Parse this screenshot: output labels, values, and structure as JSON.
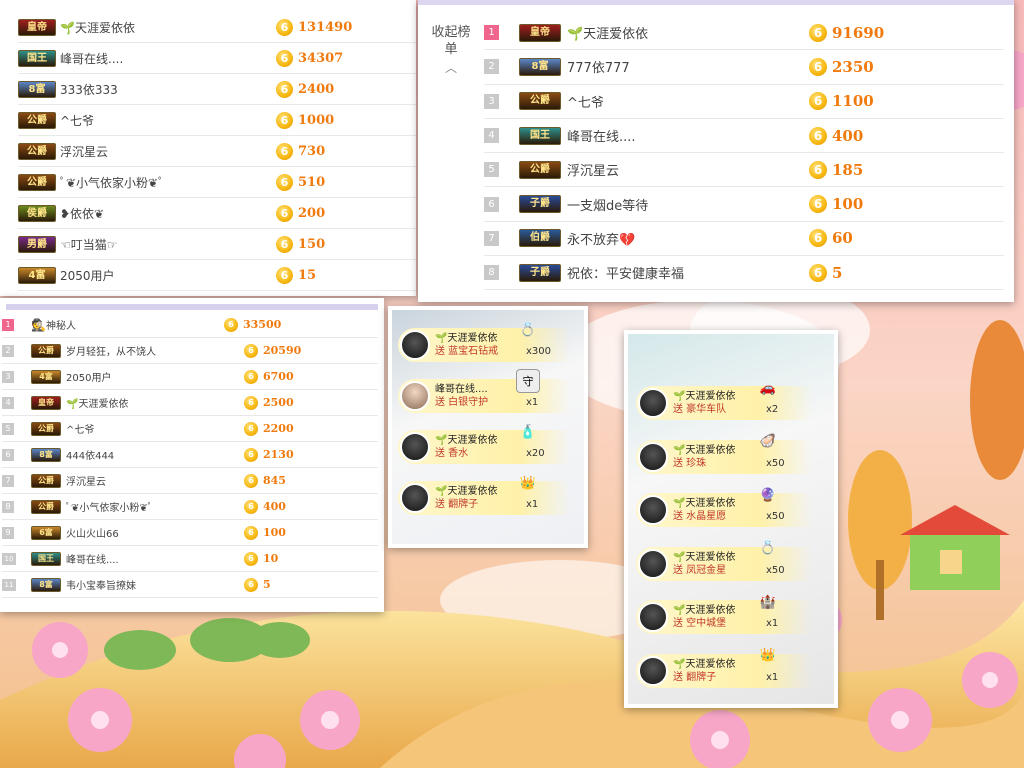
{
  "panel_top_left": {
    "rows": [
      {
        "badge": "皇帝",
        "badge_color": "#a01e1e",
        "name": "🌱天涯爱依依",
        "score": "131490"
      },
      {
        "badge": "国王",
        "badge_color": "#2e8f8a",
        "name": "峰哥在线....",
        "score": "34307"
      },
      {
        "badge": "8富",
        "badge_color": "#5a86c8",
        "name": "333依333",
        "score": "2400"
      },
      {
        "badge": "公爵",
        "badge_color": "#8a4a12",
        "name": "^七爷",
        "score": "1000"
      },
      {
        "badge": "公爵",
        "badge_color": "#8a4a12",
        "name": "浮沉星云",
        "score": "730"
      },
      {
        "badge": "公爵",
        "badge_color": "#8a4a12",
        "name": "ﾟ❦小气依家小粉❦ﾟ",
        "score": "510"
      },
      {
        "badge": "侯爵",
        "badge_color": "#6b8a1e",
        "name": "❥依依❦",
        "score": "200"
      },
      {
        "badge": "男爵",
        "badge_color": "#7a2a8a",
        "name": "☜叮当猫☞",
        "score": "150"
      },
      {
        "badge": "4富",
        "badge_color": "#c8882a",
        "name": "2050用户",
        "score": "15"
      }
    ]
  },
  "panel_top_right": {
    "collapse_label": "收起榜单",
    "collapse_icon": "chevron-up-icon",
    "rows": [
      {
        "rank": "1",
        "badge": "皇帝",
        "badge_color": "#a01e1e",
        "name": "🌱天涯爱依依",
        "score": "91690"
      },
      {
        "rank": "2",
        "badge": "8富",
        "badge_color": "#5a86c8",
        "name": "777依777",
        "score": "2350"
      },
      {
        "rank": "3",
        "badge": "公爵",
        "badge_color": "#8a4a12",
        "name": "^七爷",
        "score": "1100"
      },
      {
        "rank": "4",
        "badge": "国王",
        "badge_color": "#2e8f8a",
        "name": "峰哥在线....",
        "score": "400"
      },
      {
        "rank": "5",
        "badge": "公爵",
        "badge_color": "#8a4a12",
        "name": "浮沉星云",
        "score": "185"
      },
      {
        "rank": "6",
        "badge": "子爵",
        "badge_color": "#2a4a9a",
        "name": "一支烟de等待",
        "score": "100"
      },
      {
        "rank": "7",
        "badge": "伯爵",
        "badge_color": "#2a5a9a",
        "name": "永不放弃💔",
        "score": "60"
      },
      {
        "rank": "8",
        "badge": "子爵",
        "badge_color": "#2a4a9a",
        "name": "祝依：平安健康幸福",
        "score": "5"
      }
    ]
  },
  "panel_bottom_left": {
    "rows": [
      {
        "rank": "1",
        "badge": "",
        "badge_color": "",
        "name": "神秘人",
        "score": "33500"
      },
      {
        "rank": "2",
        "badge": "公爵",
        "badge_color": "#8a4a12",
        "name": "岁月轻狂，从不饶人",
        "score": "20590"
      },
      {
        "rank": "3",
        "badge": "4富",
        "badge_color": "#c8882a",
        "name": "2050用户",
        "score": "6700"
      },
      {
        "rank": "4",
        "badge": "皇帝",
        "badge_color": "#a01e1e",
        "name": "🌱天涯爱依依",
        "score": "2500"
      },
      {
        "rank": "5",
        "badge": "公爵",
        "badge_color": "#8a4a12",
        "name": "^七爷",
        "score": "2200"
      },
      {
        "rank": "6",
        "badge": "8富",
        "badge_color": "#5a86c8",
        "name": "444依444",
        "score": "2130"
      },
      {
        "rank": "7",
        "badge": "公爵",
        "badge_color": "#8a4a12",
        "name": "浮沉星云",
        "score": "845"
      },
      {
        "rank": "8",
        "badge": "公爵",
        "badge_color": "#8a4a12",
        "name": "ﾟ❦小气依家小粉❦ﾟ",
        "score": "400"
      },
      {
        "rank": "9",
        "badge": "6富",
        "badge_color": "#c8882a",
        "name": "火山火山66",
        "score": "100"
      },
      {
        "rank": "10",
        "badge": "国王",
        "badge_color": "#2e8f8a",
        "name": "峰哥在线....",
        "score": "10"
      },
      {
        "rank": "11",
        "badge": "8富",
        "badge_color": "#5a86c8",
        "name": "韦小宝奉旨撩妹",
        "score": "5"
      }
    ]
  },
  "gifts_small": [
    {
      "name": "🌱天涯爱依依",
      "desc": "送 蓝宝石钻戒",
      "qty": "x300",
      "icon": "sapphire-ring-icon",
      "avatar": "dark"
    },
    {
      "name": "峰哥在线....",
      "desc": "送 白银守护",
      "qty": "x1",
      "icon": "silver-guard-icon",
      "avatar": "girl"
    },
    {
      "name": "🌱天涯爱依依",
      "desc": "送 香水",
      "qty": "x20",
      "icon": "perfume-icon",
      "avatar": "dark"
    },
    {
      "name": "🌱天涯爱依依",
      "desc": "送 翻牌子",
      "qty": "x1",
      "icon": "emperor-icon",
      "avatar": "dark"
    }
  ],
  "gifts_large": [
    {
      "name": "🌱天涯爱依依",
      "desc": "送 豪华车队",
      "qty": "x2",
      "icon": "car-icon"
    },
    {
      "name": "🌱天涯爱依依",
      "desc": "送 珍珠",
      "qty": "x50",
      "icon": "pearl-icon"
    },
    {
      "name": "🌱天涯爱依依",
      "desc": "送 水晶星愿",
      "qty": "x50",
      "icon": "crystal-ball-icon"
    },
    {
      "name": "🌱天涯爱依依",
      "desc": "送 凤冠金星",
      "qty": "x50",
      "icon": "gold-ring-icon"
    },
    {
      "name": "🌱天涯爱依依",
      "desc": "送 空中城堡",
      "qty": "x1",
      "icon": "castle-icon"
    },
    {
      "name": "🌱天涯爱依依",
      "desc": "送 翻牌子",
      "qty": "x1",
      "icon": "emperor-icon"
    }
  ],
  "coin_glyph": "6",
  "colors": {
    "score": "#f07a0d",
    "rank_top": "#f0658c",
    "rank": "#c9c9c9",
    "gift_text": "#c0392b"
  }
}
